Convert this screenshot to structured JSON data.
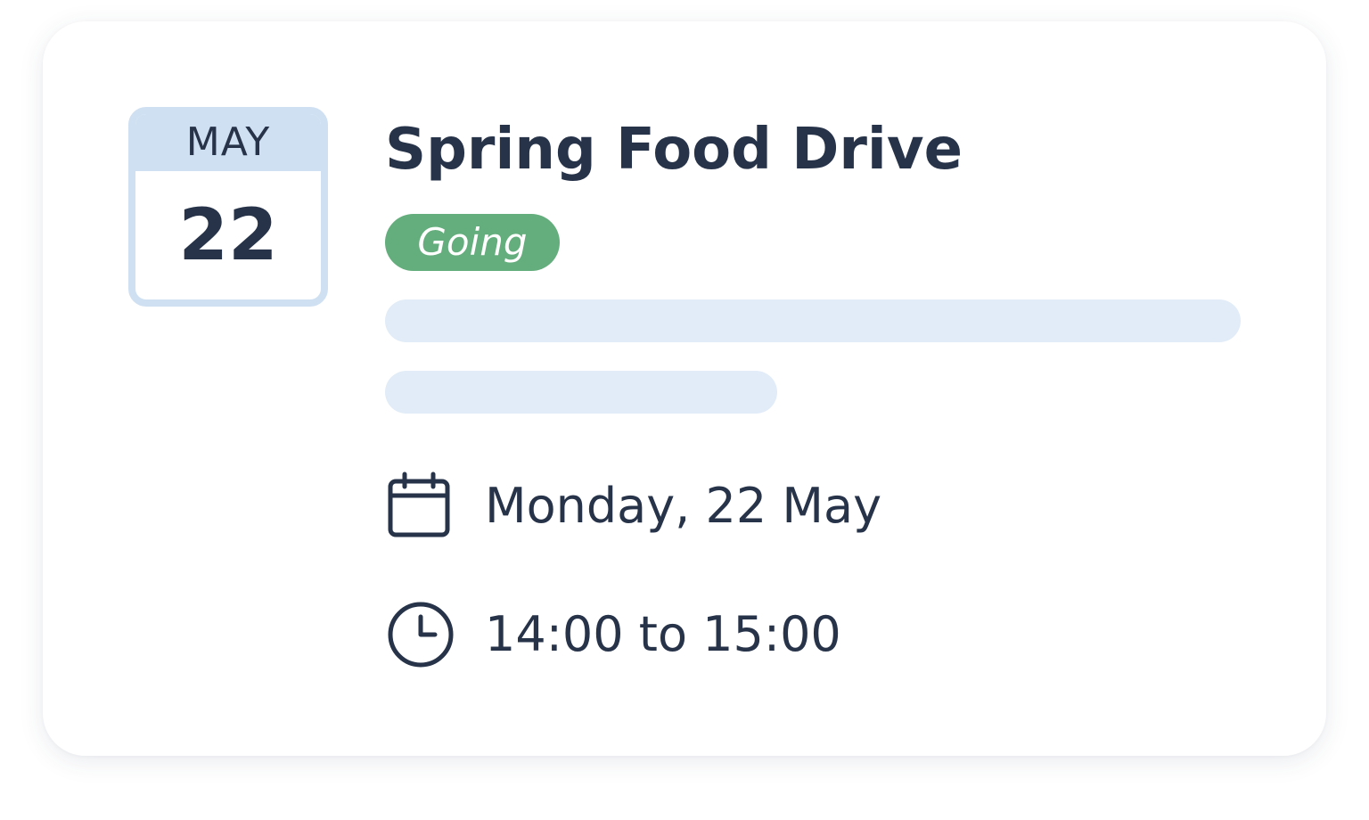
{
  "event": {
    "month": "MAY",
    "day": "22",
    "title": "Spring Food Drive",
    "status": "Going",
    "date_text": "Monday, 22 May",
    "time_text": "14:00 to 15:00"
  },
  "icons": {
    "date": "calendar-icon",
    "time": "clock-icon"
  },
  "colors": {
    "text": "#273349",
    "badge_bg": "#64ad7c",
    "tile_accent": "#cfe0f2",
    "placeholder": "#e1ecf8"
  }
}
